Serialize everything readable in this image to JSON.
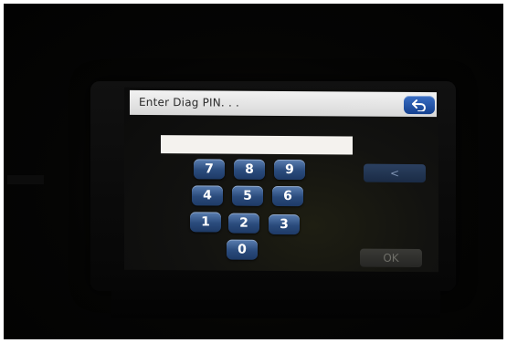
{
  "dialog": {
    "title": "Enter Diag PIN. . .",
    "pin_value": ""
  },
  "keypad": {
    "keys": [
      "7",
      "8",
      "9",
      "4",
      "5",
      "6",
      "1",
      "2",
      "3",
      "0"
    ]
  },
  "actions": {
    "backspace_label": "<",
    "ok_label": "OK"
  },
  "icons": {
    "back": "back-arrow-icon"
  },
  "colors": {
    "key_blue": "#2a4b7c",
    "title_bar": "#e6e6e6",
    "ok_disabled": "#2e2e2b"
  }
}
